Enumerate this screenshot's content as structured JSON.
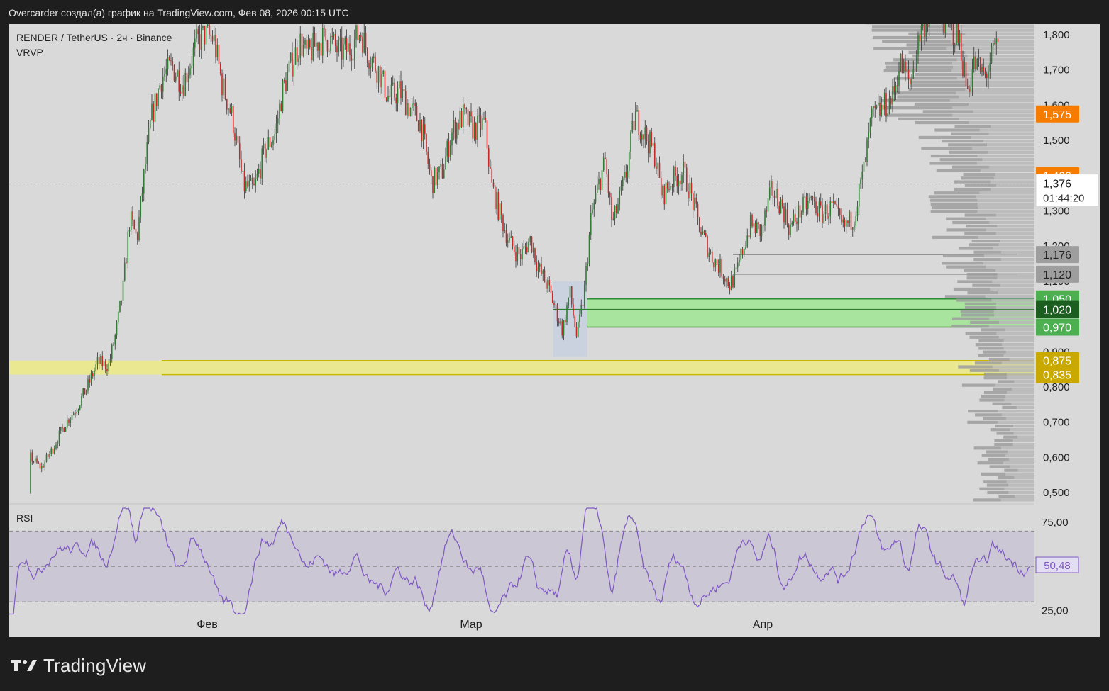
{
  "header": {
    "publish_text": "Overcarder создал(а) график на TradingView.com, Фев 08, 2026 00:15 UTC"
  },
  "legend": {
    "symbol_line": "RENDER / TetherUS · 2ч · Binance",
    "indicator": "VRVP"
  },
  "rsi": {
    "label": "RSI",
    "current_value": "50,48",
    "ticks": [
      "75,00",
      "25,00"
    ],
    "upper_band": 70,
    "middle_band": 50,
    "lower_band": 30,
    "band_color": "#9b8ac7",
    "line_color": "#7e57c2"
  },
  "price_axis": {
    "ticks": [
      "1,800",
      "1,700",
      "1,600",
      "1,500",
      "1,300",
      "1,200",
      "1,100",
      "0,900",
      "0,800",
      "0,700",
      "0,600",
      "0,500"
    ],
    "last_price": "1,376",
    "countdown": "01:44:20"
  },
  "price_labels": [
    {
      "text": "1,575",
      "value": 1.575,
      "color": "#f57c00"
    },
    {
      "text": "1,400",
      "value": 1.4,
      "color": "#f57c00"
    },
    {
      "text": "1,176",
      "value": 1.176,
      "color": "#9e9e9e"
    },
    {
      "text": "1,120",
      "value": 1.12,
      "color": "#9e9e9e"
    },
    {
      "text": "1,050",
      "value": 1.05,
      "color": "#4caf50"
    },
    {
      "text": "1,020",
      "value": 1.02,
      "color": "#1b5e20"
    },
    {
      "text": "0,970",
      "value": 0.97,
      "color": "#4caf50"
    },
    {
      "text": "0,875",
      "value": 0.875,
      "color": "#c9a800"
    },
    {
      "text": "0,835",
      "value": 0.835,
      "color": "#c9a800"
    }
  ],
  "time_axis": {
    "labels": [
      "Фев",
      "Мар",
      "Апр"
    ]
  },
  "zones": {
    "green": {
      "high": 1.05,
      "mid": 1.02,
      "low": 0.97,
      "color": "#a6e59b"
    },
    "yellow": {
      "high": 0.875,
      "low": 0.835,
      "color": "#ece98a"
    },
    "levels_grey": [
      1.176,
      1.12
    ]
  },
  "colors": {
    "background": "#d9d9d9",
    "candle_up": "#2e7d32",
    "candle_down": "#c62828",
    "candle_wick": "#333333",
    "vrvp": "#9e9e9e"
  },
  "footer": {
    "brand": "TradingView"
  },
  "chart_data": {
    "type": "candlestick",
    "series": [
      {
        "name": "RENDER / TetherUS",
        "anchors": [
          [
            0,
            0.5
          ],
          [
            25,
            0.61
          ],
          [
            45,
            0.57
          ],
          [
            60,
            0.62
          ],
          [
            80,
            0.7
          ],
          [
            95,
            0.74
          ],
          [
            110,
            0.8
          ],
          [
            125,
            0.87
          ],
          [
            140,
            0.86
          ],
          [
            150,
            0.95
          ],
          [
            160,
            1.07
          ],
          [
            170,
            1.28
          ],
          [
            180,
            1.22
          ],
          [
            190,
            1.4
          ],
          [
            200,
            1.56
          ],
          [
            215,
            1.68
          ],
          [
            230,
            1.71
          ],
          [
            245,
            1.66
          ],
          [
            265,
            1.78
          ],
          [
            275,
            1.8
          ],
          [
            288,
            1.79
          ],
          [
            300,
            1.66
          ],
          [
            315,
            1.56
          ],
          [
            330,
            1.37
          ],
          [
            345,
            1.36
          ],
          [
            360,
            1.47
          ],
          [
            375,
            1.52
          ],
          [
            385,
            1.64
          ],
          [
            395,
            1.7
          ],
          [
            410,
            1.78
          ],
          [
            420,
            1.74
          ],
          [
            435,
            1.78
          ],
          [
            450,
            1.79
          ],
          [
            465,
            1.75
          ],
          [
            480,
            1.76
          ],
          [
            495,
            1.81
          ],
          [
            505,
            1.75
          ],
          [
            520,
            1.7
          ],
          [
            535,
            1.62
          ],
          [
            550,
            1.64
          ],
          [
            565,
            1.59
          ],
          [
            580,
            1.55
          ],
          [
            595,
            1.38
          ],
          [
            610,
            1.41
          ],
          [
            625,
            1.53
          ],
          [
            640,
            1.57
          ],
          [
            655,
            1.53
          ],
          [
            670,
            1.55
          ],
          [
            680,
            1.37
          ],
          [
            690,
            1.3
          ],
          [
            705,
            1.21
          ],
          [
            720,
            1.17
          ],
          [
            735,
            1.22
          ],
          [
            745,
            1.14
          ],
          [
            760,
            1.08
          ],
          [
            770,
            1.02
          ],
          [
            780,
            0.96
          ],
          [
            790,
            1.07
          ],
          [
            800,
            0.94
          ],
          [
            810,
            1.06
          ],
          [
            820,
            1.28
          ],
          [
            830,
            1.37
          ],
          [
            840,
            1.44
          ],
          [
            850,
            1.26
          ],
          [
            860,
            1.33
          ],
          [
            870,
            1.41
          ],
          [
            882,
            1.57
          ],
          [
            895,
            1.52
          ],
          [
            910,
            1.46
          ],
          [
            920,
            1.34
          ],
          [
            935,
            1.39
          ],
          [
            950,
            1.41
          ],
          [
            960,
            1.35
          ],
          [
            975,
            1.24
          ],
          [
            990,
            1.17
          ],
          [
            1005,
            1.13
          ],
          [
            1015,
            1.09
          ],
          [
            1025,
            1.12
          ],
          [
            1035,
            1.2
          ],
          [
            1045,
            1.26
          ],
          [
            1060,
            1.24
          ],
          [
            1075,
            1.36
          ],
          [
            1090,
            1.31
          ],
          [
            1100,
            1.25
          ],
          [
            1115,
            1.3
          ],
          [
            1130,
            1.33
          ],
          [
            1145,
            1.29
          ],
          [
            1160,
            1.31
          ],
          [
            1175,
            1.25
          ],
          [
            1190,
            1.28
          ],
          [
            1205,
            1.42
          ],
          [
            1215,
            1.56
          ],
          [
            1230,
            1.59
          ],
          [
            1245,
            1.62
          ],
          [
            1255,
            1.72
          ],
          [
            1270,
            1.66
          ],
          [
            1285,
            1.82
          ],
          [
            1300,
            1.87
          ],
          [
            1320,
            1.84
          ],
          [
            1340,
            1.78
          ],
          [
            1350,
            1.64
          ],
          [
            1360,
            1.72
          ],
          [
            1375,
            1.68
          ],
          [
            1390,
            1.76
          ],
          [
            1410,
            1.79
          ]
        ]
      }
    ],
    "y_range": [
      0.47,
      1.83
    ],
    "rsi_range": [
      20,
      85
    ]
  }
}
